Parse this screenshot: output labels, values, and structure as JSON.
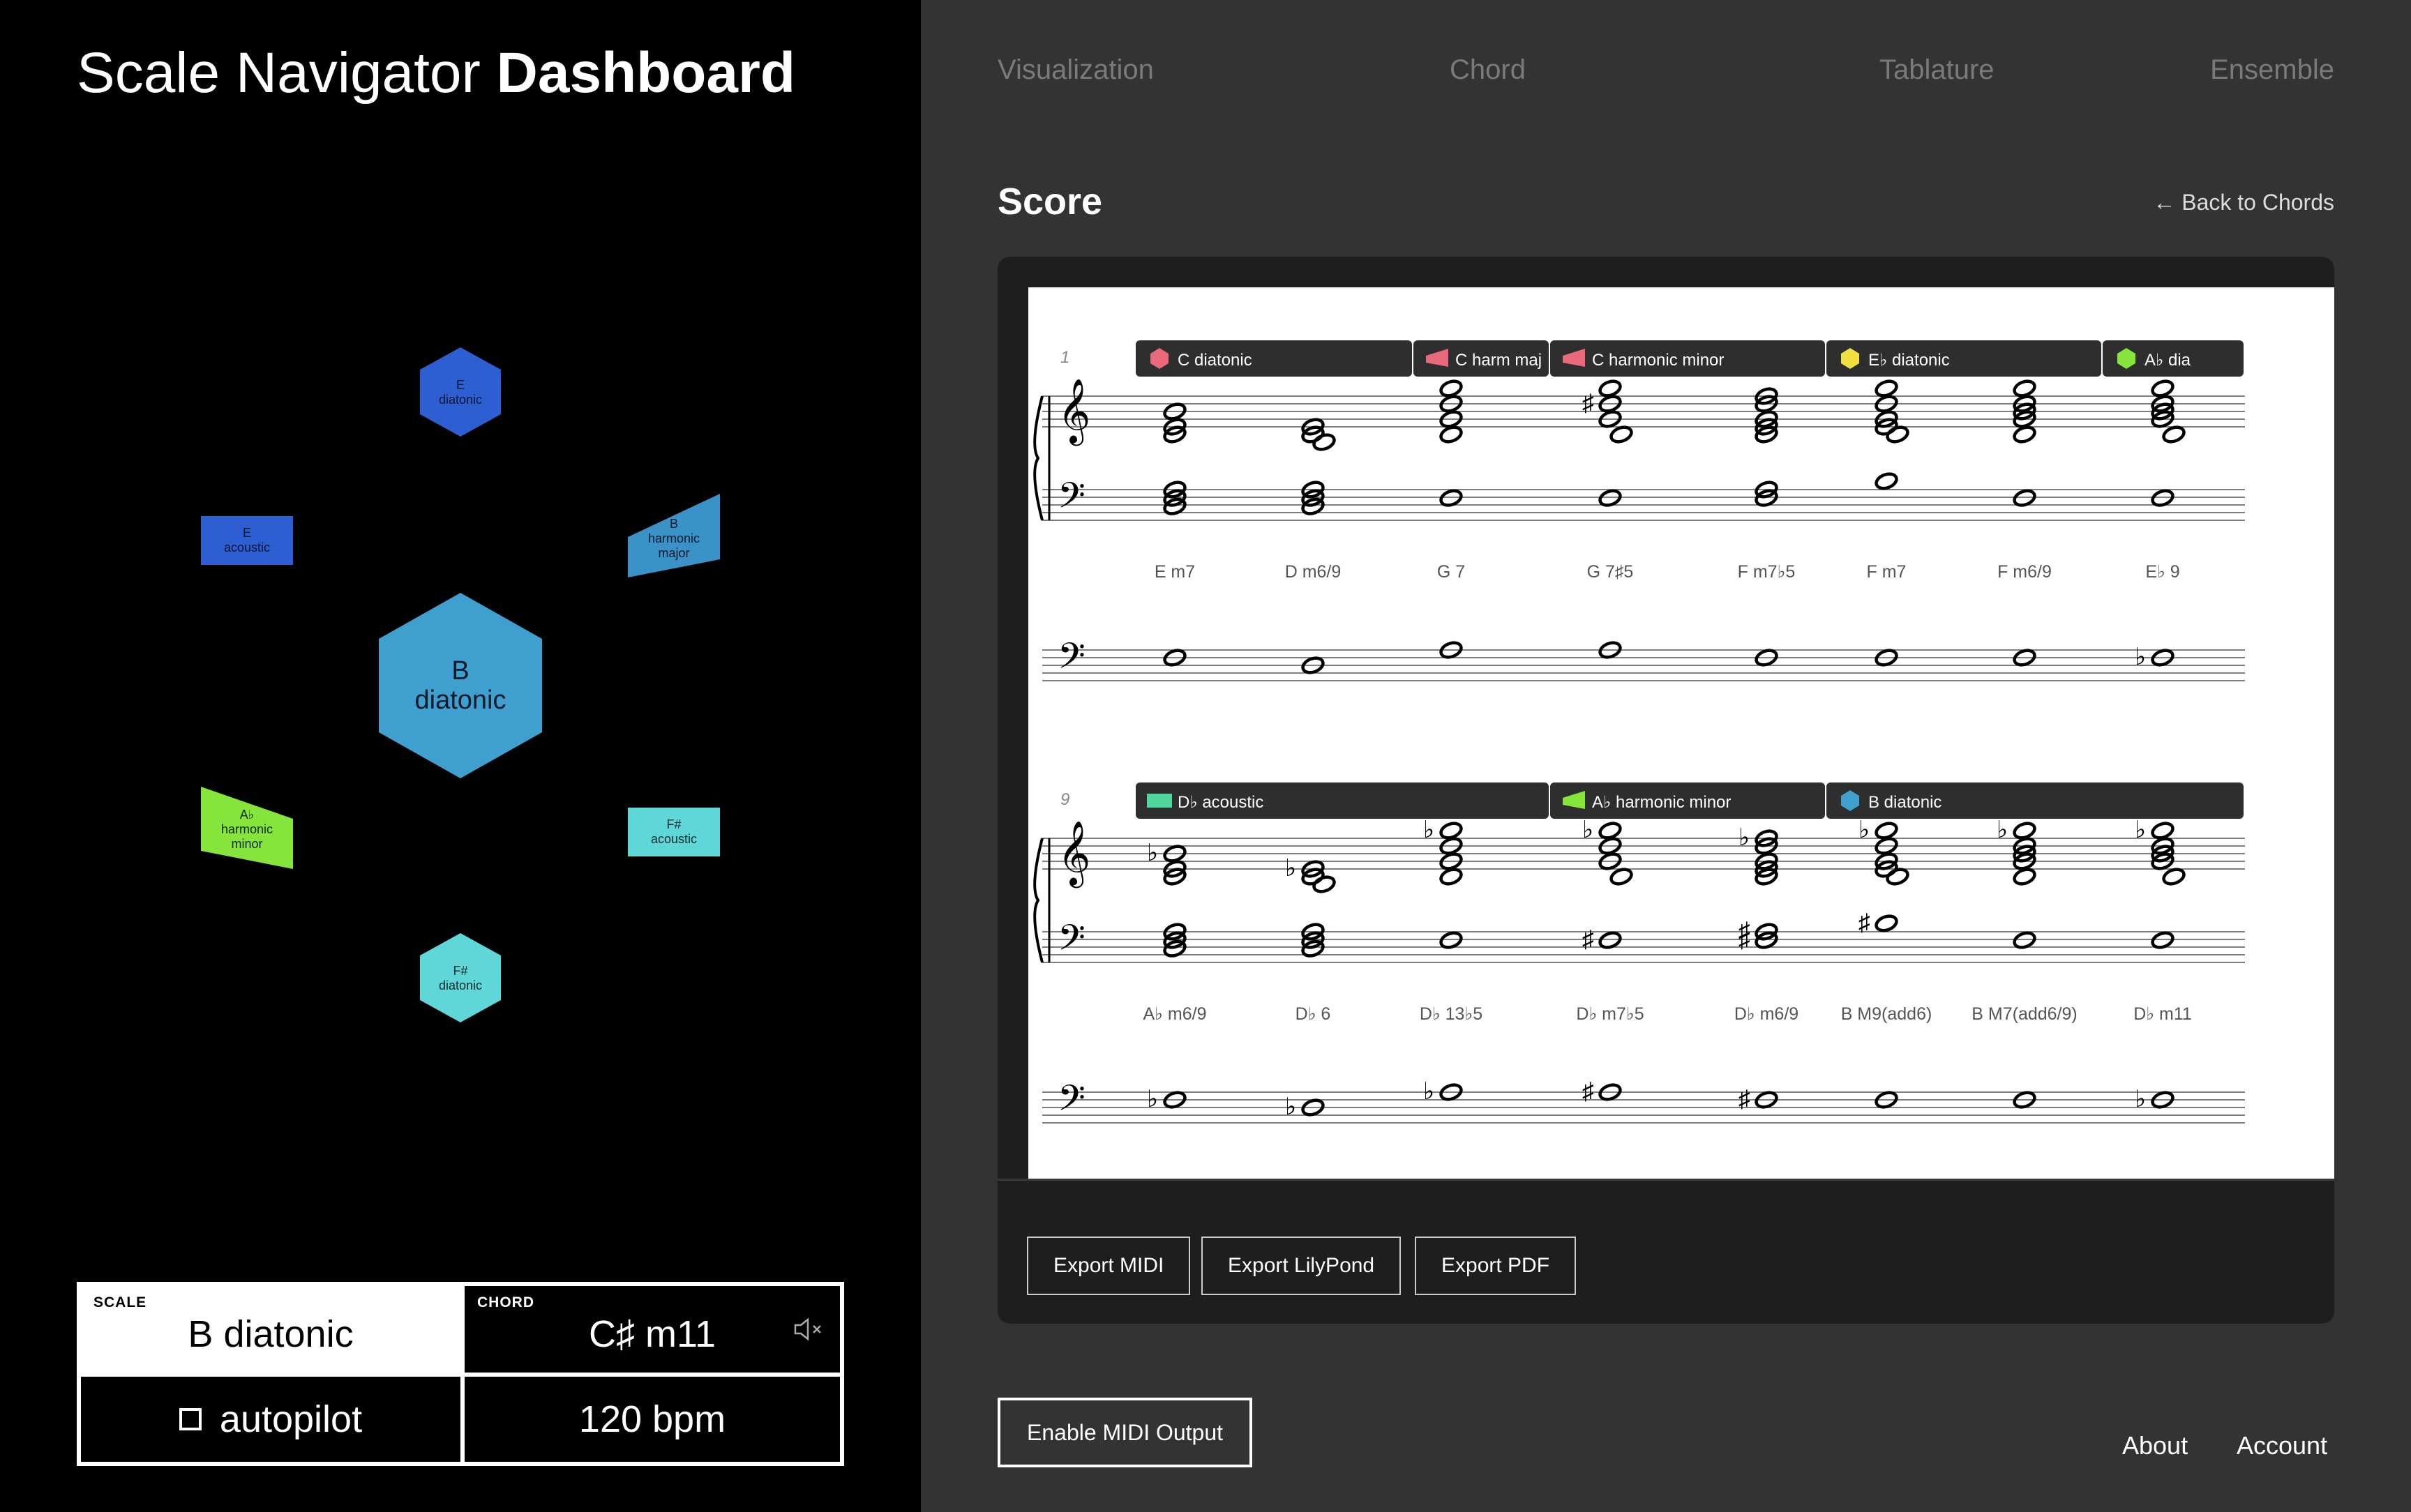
{
  "app": {
    "title_light": "Scale Navigator",
    "title_bold": "Dashboard"
  },
  "nav": {
    "tabs": [
      "Visualization",
      "Chord",
      "Tablature",
      "Ensemble"
    ]
  },
  "graph": {
    "center": {
      "line1": "B",
      "line2": "diatonic",
      "color": "#3fa0d0"
    },
    "nodes": [
      {
        "lines": [
          "E",
          "diatonic"
        ],
        "shape": "hexagon",
        "color": "#2e5fd2"
      },
      {
        "lines": [
          "E",
          "acoustic"
        ],
        "shape": "rectangle",
        "color": "#2e5fd2"
      },
      {
        "lines": [
          "B",
          "harmonic",
          "major"
        ],
        "shape": "trapezoid",
        "color": "#3a92c8"
      },
      {
        "lines": [
          "A♭",
          "harmonic",
          "minor"
        ],
        "shape": "trapezoid",
        "color": "#86e53a"
      },
      {
        "lines": [
          "F#",
          "acoustic"
        ],
        "shape": "rectangle",
        "color": "#5fd6d8"
      },
      {
        "lines": [
          "F#",
          "diatonic"
        ],
        "shape": "hexagon",
        "color": "#5fd6d8"
      }
    ]
  },
  "status": {
    "scale_label": "SCALE",
    "scale_value": "B diatonic",
    "chord_label": "CHORD",
    "chord_value": "C♯ m11",
    "autopilot": "autopilot",
    "tempo": "120 bpm",
    "mute_icon": "speaker-muted-icon"
  },
  "score": {
    "heading": "Score",
    "back_link": "← Back to Chords",
    "systems": [
      {
        "measure_number": "1",
        "scale_bars": [
          {
            "label": "C diatonic",
            "color": "#e86a7a",
            "shape": "hexagon"
          },
          {
            "label": "C harm maj",
            "color": "#e86a7a",
            "shape": "trapezoid"
          },
          {
            "label": "C harmonic minor",
            "color": "#e86a7a",
            "shape": "trapezoid"
          },
          {
            "label": "E♭ diatonic",
            "color": "#f0e040",
            "shape": "hexagon"
          },
          {
            "label": "A♭ dia",
            "color": "#86e53a",
            "shape": "hexagon"
          }
        ],
        "chords": [
          "E m7",
          "D m6/9",
          "G 7",
          "G 7♯5",
          "F m7♭5",
          "F m7",
          "F m6/9",
          "E♭ 9"
        ]
      },
      {
        "measure_number": "9",
        "scale_bars": [
          {
            "label": "D♭ acoustic",
            "color": "#4fd69a",
            "shape": "rectangle"
          },
          {
            "label": "A♭ harmonic minor",
            "color": "#86e53a",
            "shape": "trapezoid"
          },
          {
            "label": "B diatonic",
            "color": "#3fa0d0",
            "shape": "hexagon"
          }
        ],
        "chords": [
          "A♭ m6/9",
          "D♭ 6",
          "D♭ 13♭5",
          "D♭ m7♭5",
          "D♭ m6/9",
          "B M9(add6)",
          "B M7(add6/9)",
          "D♭ m11"
        ]
      }
    ],
    "exports": [
      "Export MIDI",
      "Export LilyPond",
      "Export PDF"
    ]
  },
  "footer": {
    "midi_button": "Enable MIDI Output",
    "about": "About",
    "account": "Account"
  }
}
